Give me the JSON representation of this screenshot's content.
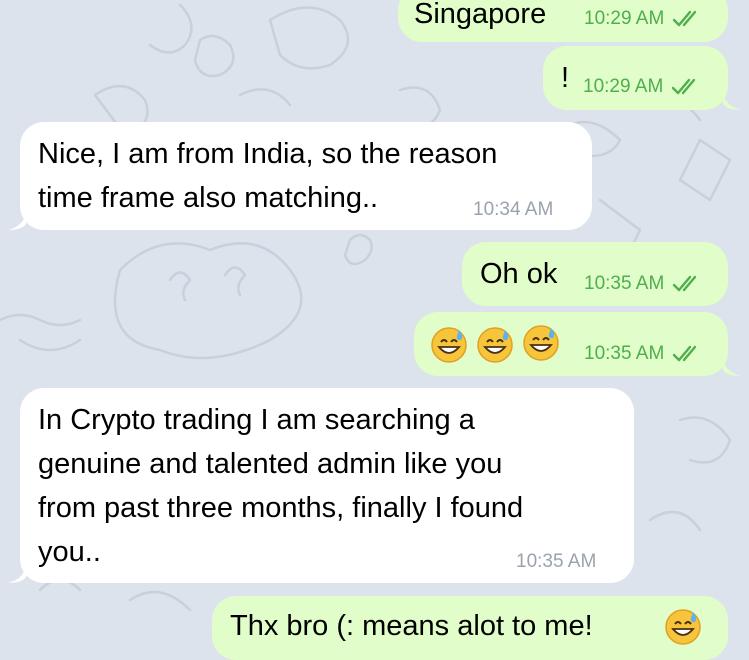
{
  "chat": {
    "messages": [
      {
        "id": "m1",
        "direction": "outgoing",
        "text": "Singapore",
        "time": "10:29 AM",
        "status": "read"
      },
      {
        "id": "m2",
        "direction": "outgoing",
        "text": "!",
        "time": "10:29 AM",
        "status": "read"
      },
      {
        "id": "m3",
        "direction": "incoming",
        "lines": [
          "Nice, I am from India, so the reason",
          "time frame also matching.."
        ],
        "time": "10:34 AM"
      },
      {
        "id": "m4",
        "direction": "outgoing",
        "text": "Oh ok",
        "time": "10:35 AM",
        "status": "read"
      },
      {
        "id": "m5",
        "direction": "outgoing",
        "emoji": [
          "grinning-face-with-sweat",
          "grinning-face-with-sweat",
          "grinning-face-with-sweat"
        ],
        "time": "10:35 AM",
        "status": "read"
      },
      {
        "id": "m6",
        "direction": "incoming",
        "lines": [
          "In Crypto trading I am searching a",
          "genuine and talented admin like you",
          "from past three months, finally I found",
          "you.."
        ],
        "time": "10:35 AM"
      },
      {
        "id": "m7",
        "direction": "outgoing",
        "text": "Thx bro (: means alot to me!",
        "emoji": [
          "grinning-face-with-sweat"
        ],
        "partial": true
      }
    ]
  },
  "colors": {
    "background": "#dde3ec",
    "outgoing_bubble": "#e1fdc9",
    "incoming_bubble": "#ffffff",
    "outgoing_time": "#4fae4e",
    "incoming_time": "#9aa3ad"
  }
}
